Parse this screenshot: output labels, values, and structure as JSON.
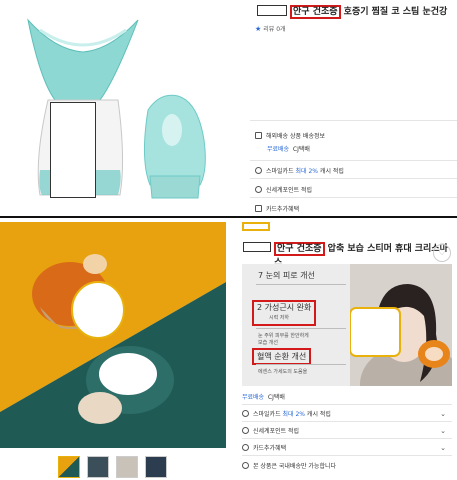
{
  "top_listing": {
    "title_highlight": "안구 건조증",
    "title_rest": " 호증기 찜질 코 스팀 눈건강",
    "review_label": "리뷰 0개",
    "shipping_info": "해외배송 상품 배송정보",
    "shipping_free": "무료배송",
    "shipping_courier": "CJ택배",
    "smile_card": "스마일카드",
    "smile_card_highlight": "최대 2%",
    "smile_card_rest": "캐시 적립",
    "shinsegae_point": "신세계포인트 적립",
    "card_benefit": "카드추가혜택"
  },
  "bottom_listing": {
    "title_highlight": "안구 건조증",
    "title_rest": " 압축 보습 스티머 휴대 크리스마스",
    "banner": {
      "line1": "7 눈의 피로 개선",
      "line2": "2 가성근시 완화",
      "line2_sub": "시력 저하",
      "line3": "눈 주위 피부를 한안하게",
      "line3_sub": "보습 개선",
      "line4": "혈액 순환 개선",
      "line5": "에센스 가세도의 도움을"
    },
    "shipping_free": "무료배송",
    "shipping_courier": "CJ택배",
    "smile_card": "스마일카드",
    "smile_card_highlight": "최대 2%",
    "smile_card_rest": "캐시 적립",
    "shinsegae_point": "신세계포인트 적립",
    "card_benefit": "카드추가혜택",
    "domestic_notice": "본 상품은 국내배송만 가능합니다",
    "thumbnails": [
      "thumb-1",
      "thumb-2",
      "thumb-3",
      "thumb-4"
    ]
  },
  "colors": {
    "teal": "#7fd3d0",
    "orange": "#e8a20f",
    "dark_teal": "#1f5a55",
    "highlight_red": "#d21a1a",
    "highlight_gold": "#e8b10b",
    "link_blue": "#2a6ad6"
  },
  "icons": {
    "star": "★",
    "heart": "♡",
    "chevron": "⌄"
  }
}
